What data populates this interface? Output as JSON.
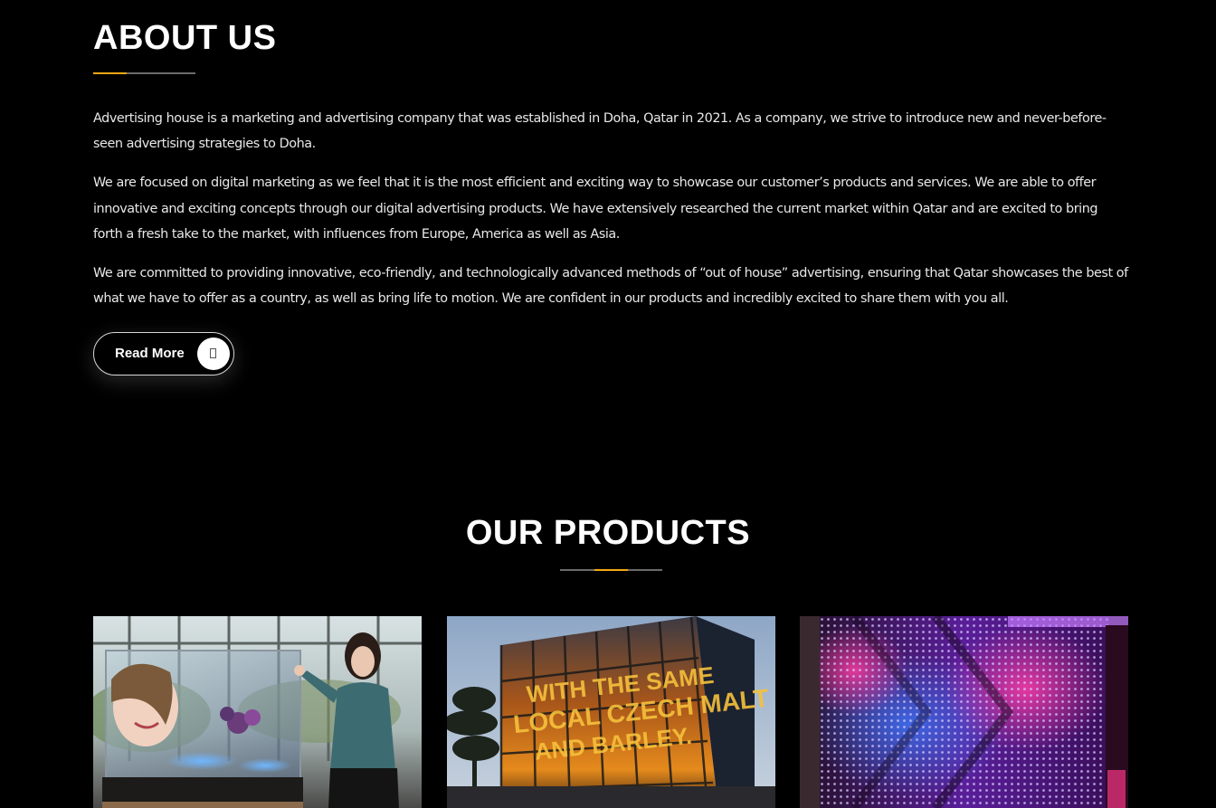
{
  "about": {
    "title": "ABOUT US",
    "paragraphs": [
      "Advertising house is a marketing and advertising company that was established in Doha, Qatar in 2021. As a company, we strive to introduce new and never-before-seen advertising strategies to Doha.",
      "We are focused on digital marketing as we feel that it is the most efficient and exciting way to showcase our customer’s products and services. We are able to offer innovative and exciting concepts through our digital advertising products. We have extensively researched the current market within Qatar and are excited to bring forth a fresh take to the market, with influences from Europe, America as well as Asia.",
      "We are committed to providing innovative, eco-friendly, and technologically advanced methods of “out of house” advertising, ensuring that Qatar showcases the best of what we have to offer as a country, as well as bring life to motion. We are confident in our products and incredibly excited to share them with you all."
    ],
    "read_more_label": "Read More",
    "read_more_icon": "arrow-icon"
  },
  "products": {
    "title": "OUR PRODUCTS",
    "items": [
      {
        "image": "transparent-led-display-with-presenter"
      },
      {
        "image": "led-glass-facade-building",
        "sign_text": [
          "WITH THE SAME",
          "LOCAL CZECH MALT",
          "AND BARLEY."
        ]
      },
      {
        "image": "purple-led-dot-wall"
      }
    ]
  },
  "colors": {
    "background": "#000000",
    "accent": "#f3a712",
    "text": "#ffffff"
  }
}
